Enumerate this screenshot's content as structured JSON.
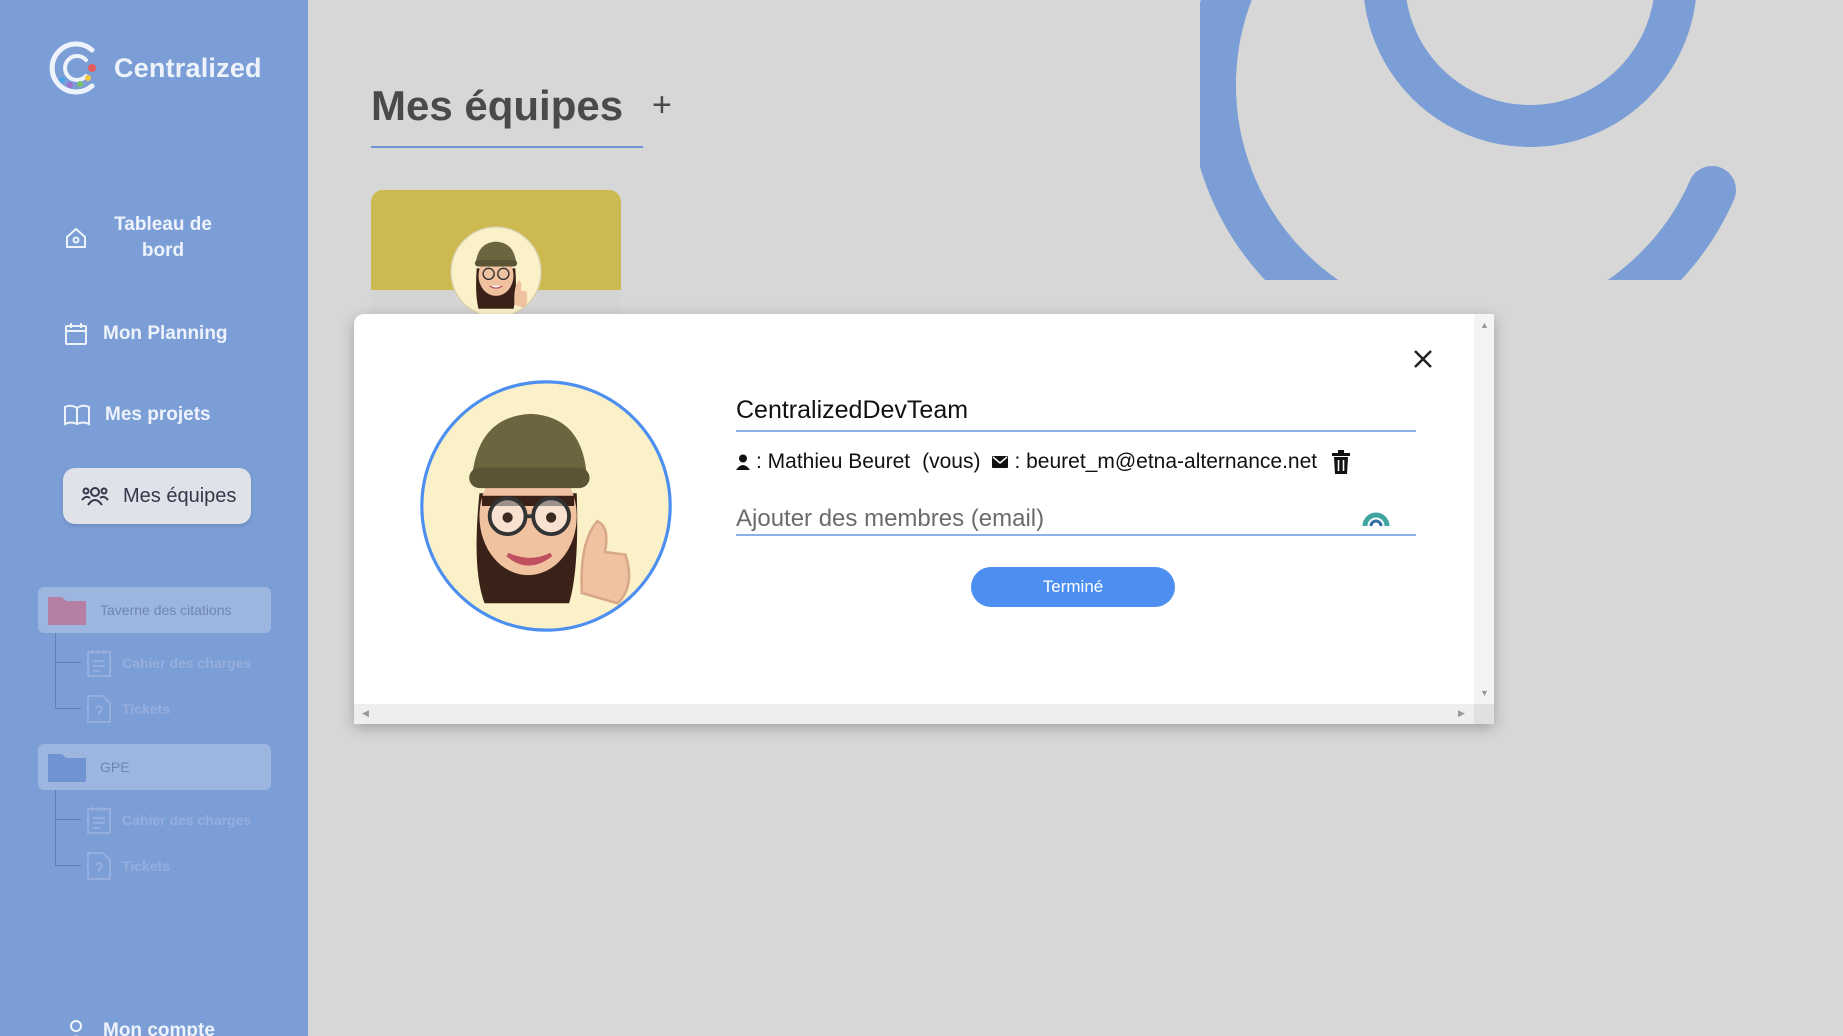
{
  "app": {
    "name": "Centralized"
  },
  "sidebar": {
    "nav": [
      {
        "label": "Tableau de bord",
        "icon": "home-icon"
      },
      {
        "label": "Mon Planning",
        "icon": "calendar-icon"
      },
      {
        "label": "Mes projets",
        "icon": "book-icon"
      },
      {
        "label": "Mes équipes",
        "icon": "team-icon"
      }
    ],
    "projects": [
      {
        "name": "Taverne des citations",
        "folder_color": "#b57fa3",
        "children": [
          {
            "label": "Cahier des charges",
            "icon": "document-icon"
          },
          {
            "label": "Tickets",
            "icon": "ticket-icon"
          }
        ]
      },
      {
        "name": "GPE",
        "folder_color": "#6f93d3",
        "children": [
          {
            "label": "Cahier des charges",
            "icon": "document-icon"
          },
          {
            "label": "Tickets",
            "icon": "ticket-icon"
          }
        ]
      }
    ],
    "account_label": "Mon compte"
  },
  "main": {
    "title": "Mes équipes",
    "add_symbol": "+"
  },
  "modal": {
    "team_name": "CentralizedDevTeam",
    "member": {
      "name_text": ": Mathieu Beuret",
      "you_tag": "(vous)",
      "email_text": ": beuret_m@etna-alternance.net"
    },
    "add_member_placeholder": "Ajouter des membres (email)",
    "done_label": "Terminé"
  },
  "colors": {
    "sidebar_bg": "#7b9ed6",
    "accent_blue": "#4d8ff0",
    "card_yellow": "#ccb94f",
    "page_bg": "#d7d7d7"
  }
}
